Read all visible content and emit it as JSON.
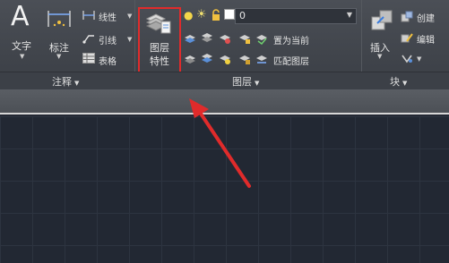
{
  "annotation_panel": {
    "text_label": "文字",
    "dimension_label": "标注",
    "linear_label": "线性",
    "leader_label": "引线",
    "table_label": "表格",
    "panel_title": "注释"
  },
  "layers_panel": {
    "layer_properties_label_line1": "图层",
    "layer_properties_label_line2": "特性",
    "current_layer_value": "0",
    "set_current_label": "置为当前",
    "match_layer_label": "匹配图层",
    "panel_title": "图层"
  },
  "block_panel": {
    "insert_label": "插入",
    "create_label": "创建",
    "edit_label": "编辑",
    "panel_title": "块"
  },
  "colors": {
    "highlight_box": "#e02b2b",
    "arrow": "#e02b2b",
    "ribbon_bg": "#44484f",
    "canvas_bg": "#222833"
  }
}
